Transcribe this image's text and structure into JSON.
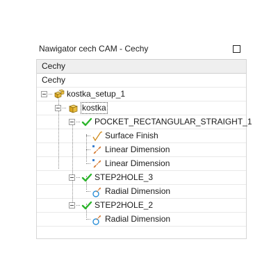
{
  "panel": {
    "title": "Nawigator cech CAM - Cechy"
  },
  "navigator": {
    "column_header": "Cechy",
    "root_label": "Cechy",
    "tree": [
      {
        "label": "kostka_setup_1",
        "icon": "setup-icon"
      },
      {
        "label": "kostka",
        "icon": "part-icon"
      },
      {
        "label": "POCKET_RECTANGULAR_STRAIGHT_1",
        "icon": "checkmark-icon"
      },
      {
        "label": "Surface Finish",
        "icon": "surface-finish-icon"
      },
      {
        "label": "Linear Dimension",
        "icon": "linear-dimension-icon"
      },
      {
        "label": "Linear Dimension",
        "icon": "linear-dimension-icon"
      },
      {
        "label": "STEP2HOLE_3",
        "icon": "checkmark-icon"
      },
      {
        "label": "Radial Dimension",
        "icon": "radial-dimension-icon"
      },
      {
        "label": "STEP2HOLE_2",
        "icon": "checkmark-icon"
      },
      {
        "label": "Radial Dimension",
        "icon": "radial-dimension-icon"
      }
    ]
  }
}
